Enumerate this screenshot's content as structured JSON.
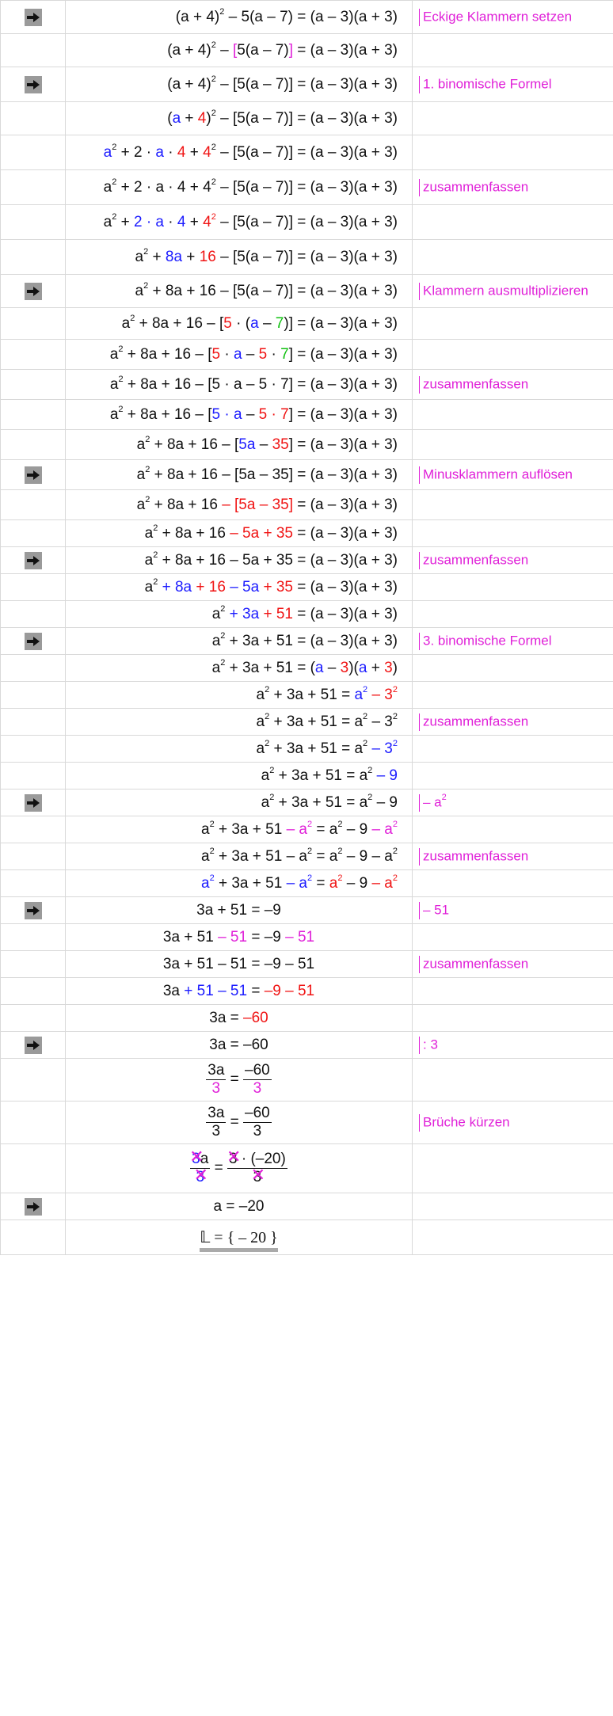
{
  "notes": {
    "brackets": "Eckige Klammern setzen",
    "binom1": "1. binomische Formel",
    "combine": "zusammenfassen",
    "expand": "Klammern ausmultiplizieren",
    "minus": "Minusklammern auflösen",
    "binom3": "3. binomische Formel",
    "sub_a2": "– a",
    "sub_51": "– 51",
    "div3": ": 3",
    "fractions": "Brüche kürzen"
  },
  "final": {
    "solution_set": "𝕃 = { – 20 }"
  }
}
